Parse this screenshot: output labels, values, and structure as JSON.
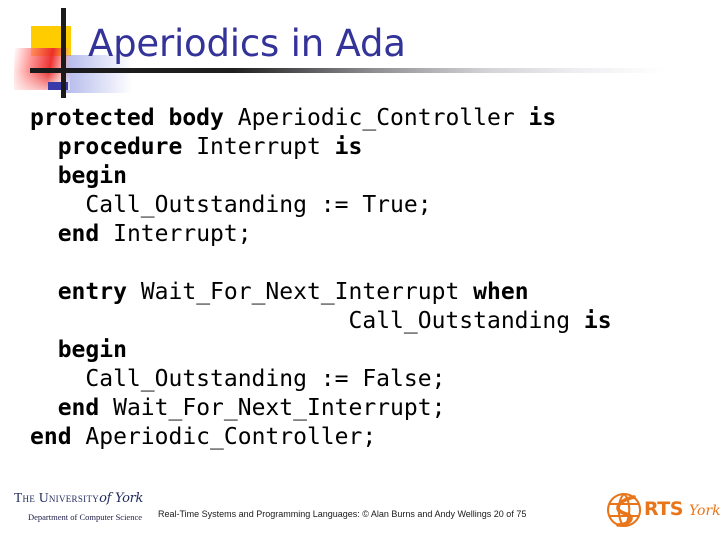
{
  "slide": {
    "title": "Aperiodics in Ada",
    "background": "#ffffff",
    "title_color": "#333399"
  },
  "decoration": {
    "yellow_color": "#ffcc00",
    "red_color": "#eb2828",
    "blue_color": "#3a3aa8",
    "bar_color": "#1b1b1b"
  },
  "code": {
    "language": "Ada",
    "lines": [
      {
        "indent": 0,
        "keyword": "protected body",
        "identifier": "Aperiodic_Controller",
        "trailing_keyword": "is"
      },
      {
        "indent": 2,
        "keyword": "procedure",
        "identifier": "Interrupt",
        "trailing_keyword": "is"
      },
      {
        "indent": 2,
        "keyword": "begin",
        "identifier": "",
        "trailing_keyword": ""
      },
      {
        "indent": 4,
        "keyword": "",
        "identifier": "Call_Outstanding := True;",
        "trailing_keyword": ""
      },
      {
        "indent": 2,
        "keyword": "end",
        "identifier": "Interrupt;",
        "trailing_keyword": ""
      },
      {
        "indent": 0,
        "keyword": "",
        "identifier": "",
        "trailing_keyword": "",
        "blank": true
      },
      {
        "indent": 2,
        "keyword": "entry",
        "identifier": "Wait_For_Next_Interrupt",
        "trailing_keyword": "when"
      },
      {
        "indent": 23,
        "keyword": "",
        "identifier": "Call_Outstanding",
        "trailing_keyword": "is"
      },
      {
        "indent": 2,
        "keyword": "begin",
        "identifier": "",
        "trailing_keyword": ""
      },
      {
        "indent": 4,
        "keyword": "",
        "identifier": "Call_Outstanding := False;",
        "trailing_keyword": ""
      },
      {
        "indent": 2,
        "keyword": "end",
        "identifier": "Wait_For_Next_Interrupt;",
        "trailing_keyword": ""
      },
      {
        "indent": 0,
        "keyword": "end",
        "identifier": "Aperiodic_Controller;",
        "trailing_keyword": ""
      }
    ]
  },
  "footer": {
    "note": "Real-Time Systems and Programming Languages: © Alan Burns and Andy Wellings 20 of 75",
    "slide_number": "20",
    "slide_total": "75"
  },
  "york_logo": {
    "line1_main": "The University",
    "line1_script": "of York",
    "line2": "Department of Computer Science",
    "color": "#1f2a5e"
  },
  "rts_logo": {
    "acronym": "RTS",
    "suffix": "York",
    "color": "#e8751a"
  }
}
